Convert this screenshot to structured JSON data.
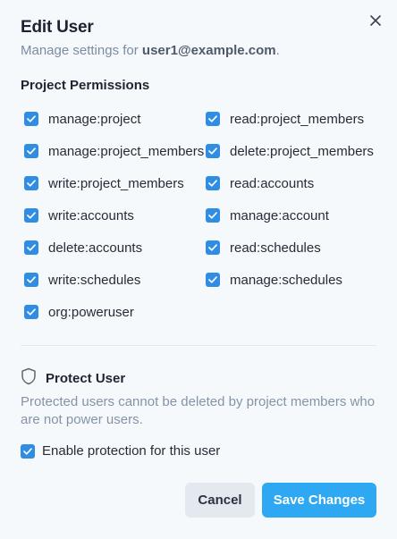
{
  "dialog": {
    "title": "Edit User",
    "subtitle_prefix": "Manage settings for ",
    "email": "user1@example.com",
    "subtitle_suffix": "."
  },
  "permissions": {
    "section_title": "Project Permissions",
    "items": [
      {
        "label": "manage:project",
        "checked": true
      },
      {
        "label": "read:project_members",
        "checked": true
      },
      {
        "label": "manage:project_members",
        "checked": true
      },
      {
        "label": "delete:project_members",
        "checked": true
      },
      {
        "label": "write:project_members",
        "checked": true
      },
      {
        "label": "read:accounts",
        "checked": true
      },
      {
        "label": "write:accounts",
        "checked": true
      },
      {
        "label": "manage:account",
        "checked": true
      },
      {
        "label": "delete:accounts",
        "checked": true
      },
      {
        "label": "read:schedules",
        "checked": true
      },
      {
        "label": "write:schedules",
        "checked": true
      },
      {
        "label": "manage:schedules",
        "checked": true
      },
      {
        "label": "org:poweruser",
        "checked": true
      }
    ]
  },
  "protect": {
    "title": "Protect User",
    "description": "Protected users cannot be deleted by project members who are not power users.",
    "enable_label": "Enable protection for this user",
    "enabled": true
  },
  "actions": {
    "cancel_label": "Cancel",
    "save_label": "Save Changes"
  },
  "colors": {
    "accent": "#2f8de4",
    "save_button": "#2ea8f2",
    "background": "#f6f9fc"
  },
  "icons": {
    "close": "close-icon",
    "shield": "shield-icon",
    "check": "checkmark-icon"
  }
}
